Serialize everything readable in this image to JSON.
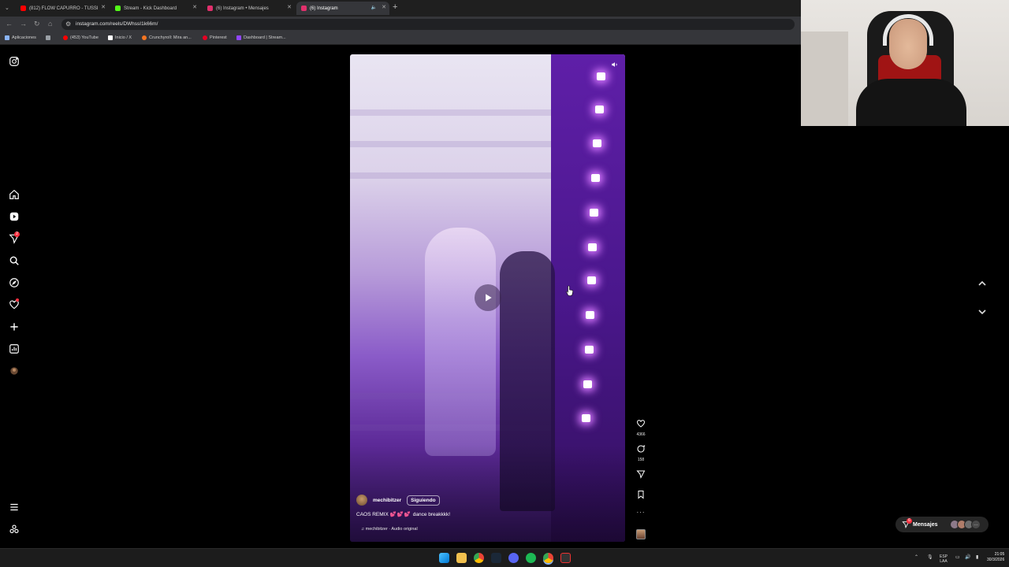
{
  "browser": {
    "tabs": [
      {
        "label": "(812) FLOW CAPURRO - TUSSI",
        "favicon_color": "#ff0000",
        "active": false
      },
      {
        "label": "Stream - Kick Dashboard",
        "favicon_color": "#53fc18",
        "active": false
      },
      {
        "label": "(6) Instagram • Mensajes",
        "favicon_color": "#e1306c",
        "active": false
      },
      {
        "label": "(6) Instagram",
        "favicon_color": "#e1306c",
        "active": true
      }
    ],
    "url": "instagram.com/reels/DWhssI1k66m/",
    "bookmarks": [
      {
        "label": "Aplicaciones",
        "color": "#8ab4f8"
      },
      {
        "label": "",
        "color": "#9aa0a6"
      },
      {
        "label": "(453) YouTube",
        "color": "#ff0000"
      },
      {
        "label": "Inicio / X",
        "color": "#ffffff"
      },
      {
        "label": "Crunchyroll: Mira an...",
        "color": "#f47521"
      },
      {
        "label": "Pinterest",
        "color": "#e60023"
      },
      {
        "label": "Dashboard | Stream...",
        "color": "#9146ff"
      }
    ]
  },
  "sidebar": {
    "notifications_badge": "2"
  },
  "reel": {
    "author": "mechibitzer",
    "follow_label": "Siguiendo",
    "caption_text": "CAOS REMIX",
    "caption_emoji": "💕💕💕",
    "caption_tail": "dance breakkkk!",
    "audio": "mechibitzer · Audio original",
    "likes": "4366",
    "comments": "158"
  },
  "messages": {
    "label": "Mensajes",
    "badge": "6"
  },
  "taskbar": {
    "lang": "ESP",
    "region": "LAA",
    "time": "21:05",
    "date": "30/3/2026"
  },
  "colors": {
    "accent_notification": "#ff3040",
    "page_background": "#000000"
  }
}
